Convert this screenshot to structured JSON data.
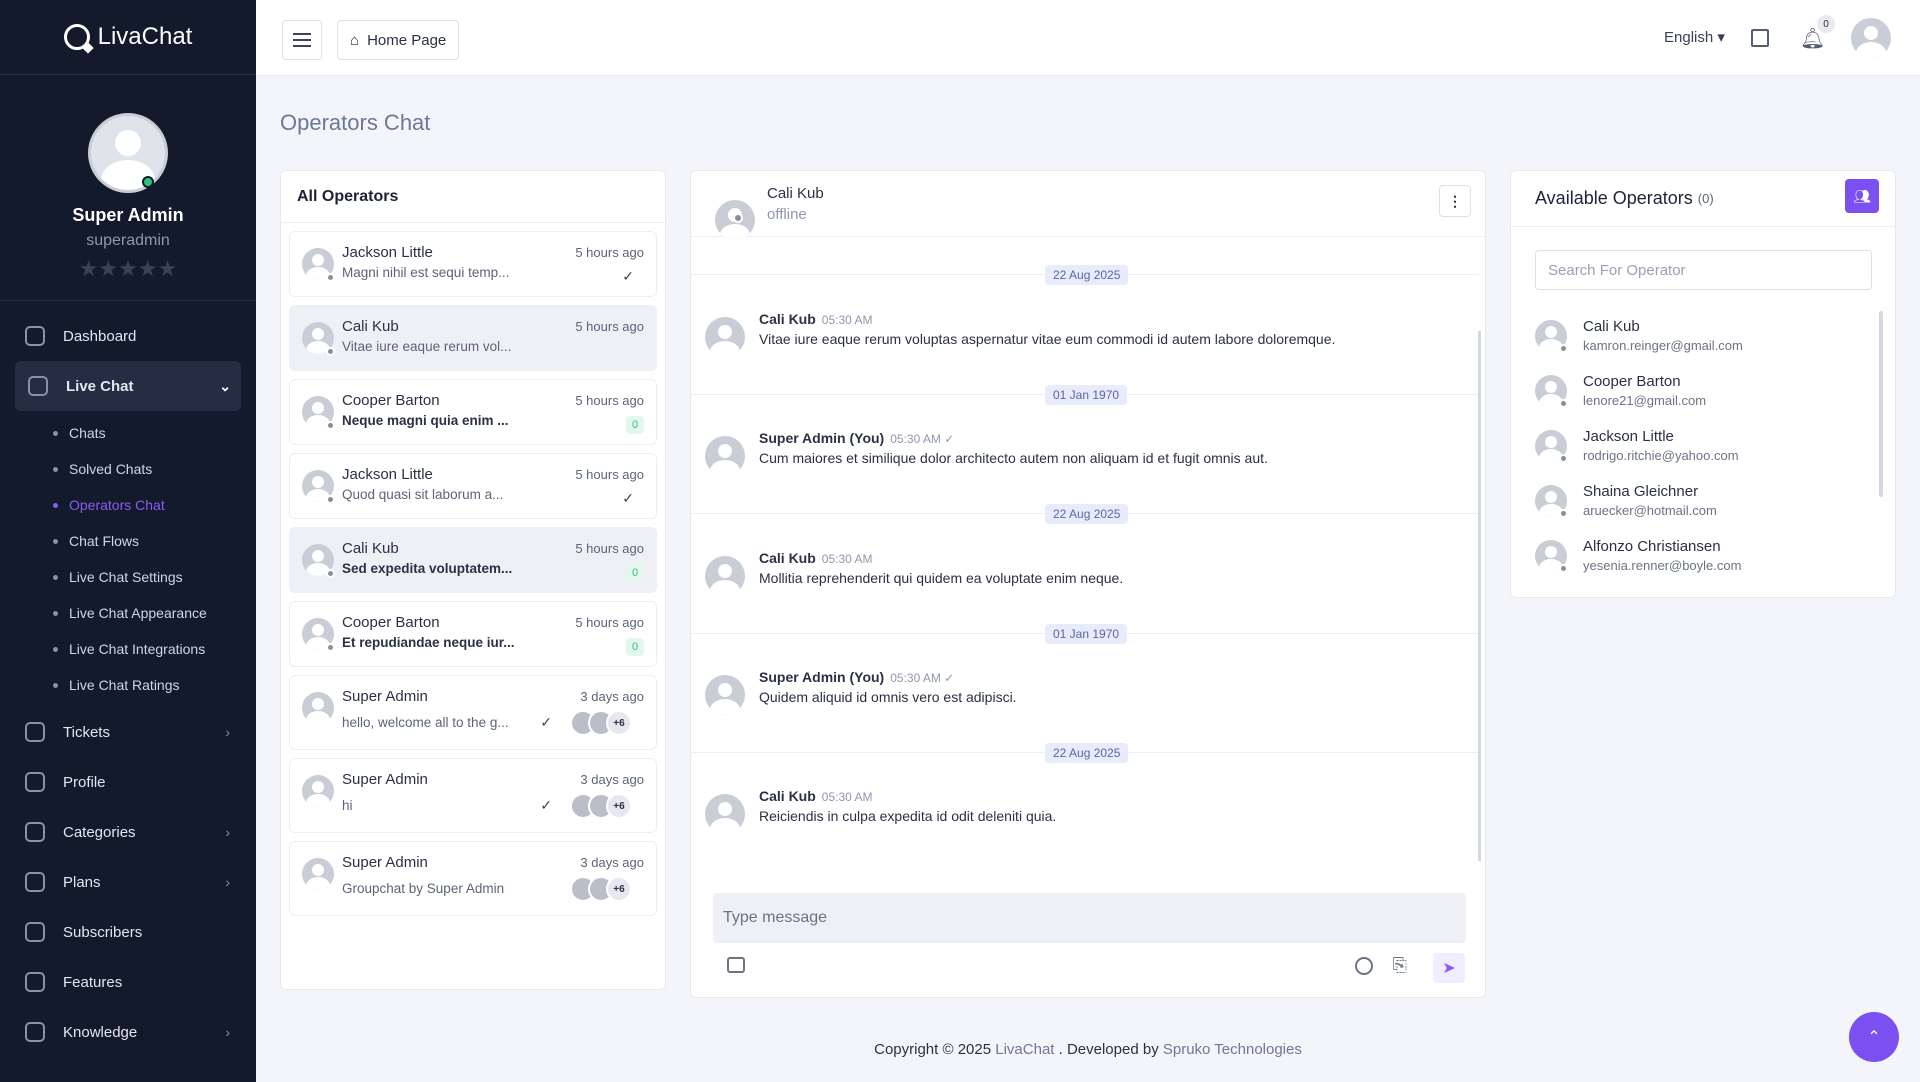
{
  "app": {
    "name": "LivaChat"
  },
  "profile": {
    "name": "Super Admin",
    "username": "superadmin",
    "stars": "★★★★★"
  },
  "nav": {
    "dashboard": "Dashboard",
    "live_chat": "Live Chat",
    "sub": [
      "Chats",
      "Solved Chats",
      "Operators Chat",
      "Chat Flows",
      "Live Chat Settings",
      "Live Chat Appearance",
      "Live Chat Integrations",
      "Live Chat Ratings"
    ],
    "tickets": "Tickets",
    "profile": "Profile",
    "categories": "Categories",
    "plans": "Plans",
    "subscribers": "Subscribers",
    "features": "Features",
    "knowledge": "Knowledge"
  },
  "topbar": {
    "home": "Home Page",
    "language": "English",
    "notifications": "0"
  },
  "page": {
    "title": "Operators Chat"
  },
  "operators": {
    "heading": "All Operators",
    "items": [
      {
        "name": "Jackson Little",
        "time": "5 hours ago",
        "message": "Magni nihil est sequi temp...",
        "status": "✓"
      },
      {
        "name": "Cali Kub",
        "time": "5 hours ago",
        "message": "Vitae iure eaque rerum vol..."
      },
      {
        "name": "Cooper Barton",
        "time": "5 hours ago",
        "message": "Neque magni quia enim ...",
        "count": "0"
      },
      {
        "name": "Jackson Little",
        "time": "5 hours ago",
        "message": "Quod quasi sit laborum a...",
        "status": "✓"
      },
      {
        "name": "Cali Kub",
        "time": "5 hours ago",
        "message": "Sed expedita voluptatem...",
        "count": "0"
      },
      {
        "name": "Cooper Barton",
        "time": "5 hours ago",
        "message": "Et repudiandae neque iur...",
        "count": "0"
      }
    ],
    "groups": [
      {
        "name": "Super Admin",
        "time": "3 days ago",
        "message": "hello, welcome all to the g...",
        "status": "✓",
        "more": "+6"
      },
      {
        "name": "Super Admin",
        "time": "3 days ago",
        "message": "hi",
        "status": "✓",
        "more": "+6"
      },
      {
        "name": "Super Admin",
        "time": "3 days ago",
        "message": "Groupchat by Super Admin",
        "more": "+6"
      }
    ]
  },
  "chat": {
    "contact": "Cali Kub",
    "status": "offline",
    "dates": [
      "22 Aug 2025",
      "01 Jan 1970",
      "22 Aug 2025",
      "01 Jan 1970",
      "22 Aug 2025"
    ],
    "messages": [
      {
        "sender": "Cali Kub",
        "time": "05:30 AM",
        "text": "Vitae iure eaque rerum voluptas aspernatur vitae eum commodi id autem labore doloremque."
      },
      {
        "sender": "Super Admin (You)",
        "time": "05:30 AM ✓",
        "text": "Cum maiores et similique dolor architecto autem non aliquam id et fugit omnis aut."
      },
      {
        "sender": "Cali Kub",
        "time": "05:30 AM",
        "text": "Mollitia reprehenderit qui quidem ea voluptate enim neque."
      },
      {
        "sender": "Super Admin (You)",
        "time": "05:30 AM ✓",
        "text": "Quidem aliquid id omnis vero est adipisci."
      },
      {
        "sender": "Cali Kub",
        "time": "05:30 AM",
        "text": "Reiciendis in culpa expedita id odit deleniti quia."
      }
    ],
    "placeholder": "Type message"
  },
  "available": {
    "heading": "Available Operators",
    "count": "(0)",
    "search_placeholder": "Search For Operator",
    "items": [
      {
        "name": "Cali Kub",
        "email": "kamron.reinger@gmail.com"
      },
      {
        "name": "Cooper Barton",
        "email": "lenore21@gmail.com"
      },
      {
        "name": "Jackson Little",
        "email": "rodrigo.ritchie@yahoo.com"
      },
      {
        "name": "Shaina Gleichner",
        "email": "aruecker@hotmail.com"
      },
      {
        "name": "Alfonzo Christiansen",
        "email": "yesenia.renner@boyle.com"
      }
    ]
  },
  "footer": {
    "prefix": "Copyright © 2025",
    "brand": "LivaChat",
    "middle": ". Developed by",
    "dev": "Spruko Technologies"
  },
  "colors": {
    "accent": "#7b50f0",
    "sidebar": "#131a2c",
    "online": "#2ec27e"
  }
}
